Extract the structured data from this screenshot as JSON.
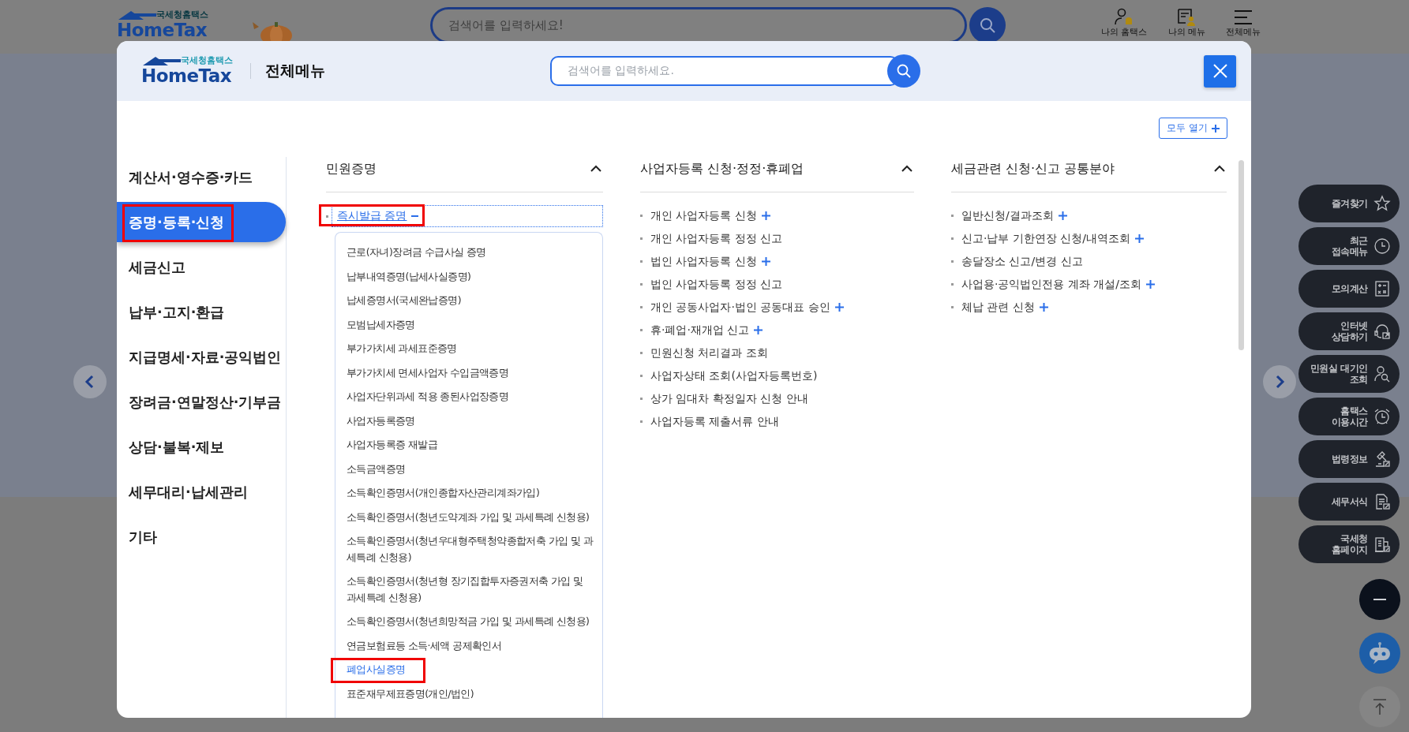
{
  "background_page": {
    "logo": {
      "caption": "국세청홈택스",
      "name": "HomeTax"
    },
    "search": {
      "placeholder": "검색어를 입력하세요!"
    },
    "header_links": [
      {
        "label": "나의 홈택스"
      },
      {
        "label": "나의 메뉴"
      },
      {
        "label": "전체메뉴"
      }
    ],
    "quick_menu": [
      {
        "label": "즐겨찾기"
      },
      {
        "label": "최근\n접속메뉴"
      },
      {
        "label": "모의계산"
      },
      {
        "label": "인터넷\n상담하기"
      },
      {
        "label": "민원실 대기인\n조회"
      },
      {
        "label": "홈택스\n이용시간"
      },
      {
        "label": "법령정보"
      },
      {
        "label": "세무서식"
      },
      {
        "label": "국세청\n홈페이지"
      }
    ]
  },
  "modal": {
    "logo": {
      "caption": "국세청홈택스",
      "name": "HomeTax"
    },
    "title": "전체메뉴",
    "search": {
      "placeholder": "검색어를 입력하세요."
    },
    "expand_all": {
      "label": "모두 열기"
    },
    "sidebar": {
      "items": [
        {
          "label": "계산서·영수증·카드",
          "selected": false,
          "annotated": false
        },
        {
          "label": "증명·등록·신청",
          "selected": true,
          "annotated": true
        },
        {
          "label": "세금신고",
          "selected": false,
          "annotated": false
        },
        {
          "label": "납부·고지·환급",
          "selected": false,
          "annotated": false
        },
        {
          "label": "지급명세·자료·공익법인",
          "selected": false,
          "annotated": false
        },
        {
          "label": "장려금·연말정산·기부금",
          "selected": false,
          "annotated": false
        },
        {
          "label": "상담·불복·제보",
          "selected": false,
          "annotated": false
        },
        {
          "label": "세무대리·납세관리",
          "selected": false,
          "annotated": false
        },
        {
          "label": "기타",
          "selected": false,
          "annotated": false
        }
      ]
    },
    "columns": [
      {
        "title": "민원증명",
        "expanded": true,
        "items": [
          {
            "label": "즉시발급 증명",
            "expanded": true,
            "annotated": true,
            "children": [
              {
                "label": "근로(자녀)장려금 수급사실 증명",
                "selected": false,
                "annotated": false
              },
              {
                "label": "납부내역증명(납세사실증명)",
                "selected": false,
                "annotated": false
              },
              {
                "label": "납세증명서(국세완납증명)",
                "selected": false,
                "annotated": false
              },
              {
                "label": "모범납세자증명",
                "selected": false,
                "annotated": false
              },
              {
                "label": "부가가치세 과세표준증명",
                "selected": false,
                "annotated": false
              },
              {
                "label": "부가가치세 면세사업자 수입금액증명",
                "selected": false,
                "annotated": false
              },
              {
                "label": "사업자단위과세 적용 종된사업장증명",
                "selected": false,
                "annotated": false
              },
              {
                "label": "사업자등록증명",
                "selected": false,
                "annotated": false
              },
              {
                "label": "사업자등록증 재발급",
                "selected": false,
                "annotated": false
              },
              {
                "label": "소득금액증명",
                "selected": false,
                "annotated": false
              },
              {
                "label": "소득확인증명서(개인종합자산관리계좌가입)",
                "selected": false,
                "annotated": false
              },
              {
                "label": "소득확인증명서(청년도약계좌 가입 및 과세특례 신청용)",
                "selected": false,
                "annotated": false
              },
              {
                "label": "소득확인증명서(청년우대형주택청약종합저축 가입 및 과세특례 신청용)",
                "selected": false,
                "annotated": false
              },
              {
                "label": "소득확인증명서(청년형 장기집합투자증권저축 가입 및 과세특례 신청용)",
                "selected": false,
                "annotated": false
              },
              {
                "label": "소득확인증명서(청년희망적금 가입 및 과세특례 신청용)",
                "selected": false,
                "annotated": false
              },
              {
                "label": "연금보험료등 소득·세액 공제확인서",
                "selected": false,
                "annotated": false
              },
              {
                "label": "폐업사실증명",
                "selected": true,
                "annotated": true
              },
              {
                "label": "표준재무제표증명(개인/법인)",
                "selected": false,
                "annotated": false
              }
            ]
          }
        ]
      },
      {
        "title": "사업자등록 신청·정정·휴폐업",
        "expanded": true,
        "items": [
          {
            "label": "개인 사업자등록 신청",
            "has_children": true
          },
          {
            "label": "개인 사업자등록 정정 신고",
            "has_children": false
          },
          {
            "label": "법인 사업자등록 신청",
            "has_children": true
          },
          {
            "label": "법인 사업자등록 정정 신고",
            "has_children": false
          },
          {
            "label": "개인 공동사업자·법인 공동대표 승인",
            "has_children": true
          },
          {
            "label": "휴·폐업·재개업 신고",
            "has_children": true
          },
          {
            "label": "민원신청 처리결과 조회",
            "has_children": false
          },
          {
            "label": "사업자상태 조회(사업자등록번호)",
            "has_children": false
          },
          {
            "label": "상가 임대차 확정일자 신청 안내",
            "has_children": false
          },
          {
            "label": "사업자등록 제출서류 안내",
            "has_children": false
          }
        ]
      },
      {
        "title": "세금관련 신청·신고 공통분야",
        "expanded": true,
        "items": [
          {
            "label": "일반신청/결과조회",
            "has_children": true
          },
          {
            "label": "신고·납부 기한연장 신청/내역조회",
            "has_children": true
          },
          {
            "label": "송달장소 신고/변경 신고",
            "has_children": false
          },
          {
            "label": "사업용·공익법인전용 계좌 개설/조회",
            "has_children": true
          },
          {
            "label": "체납 관련 신청",
            "has_children": true
          }
        ]
      }
    ]
  }
}
